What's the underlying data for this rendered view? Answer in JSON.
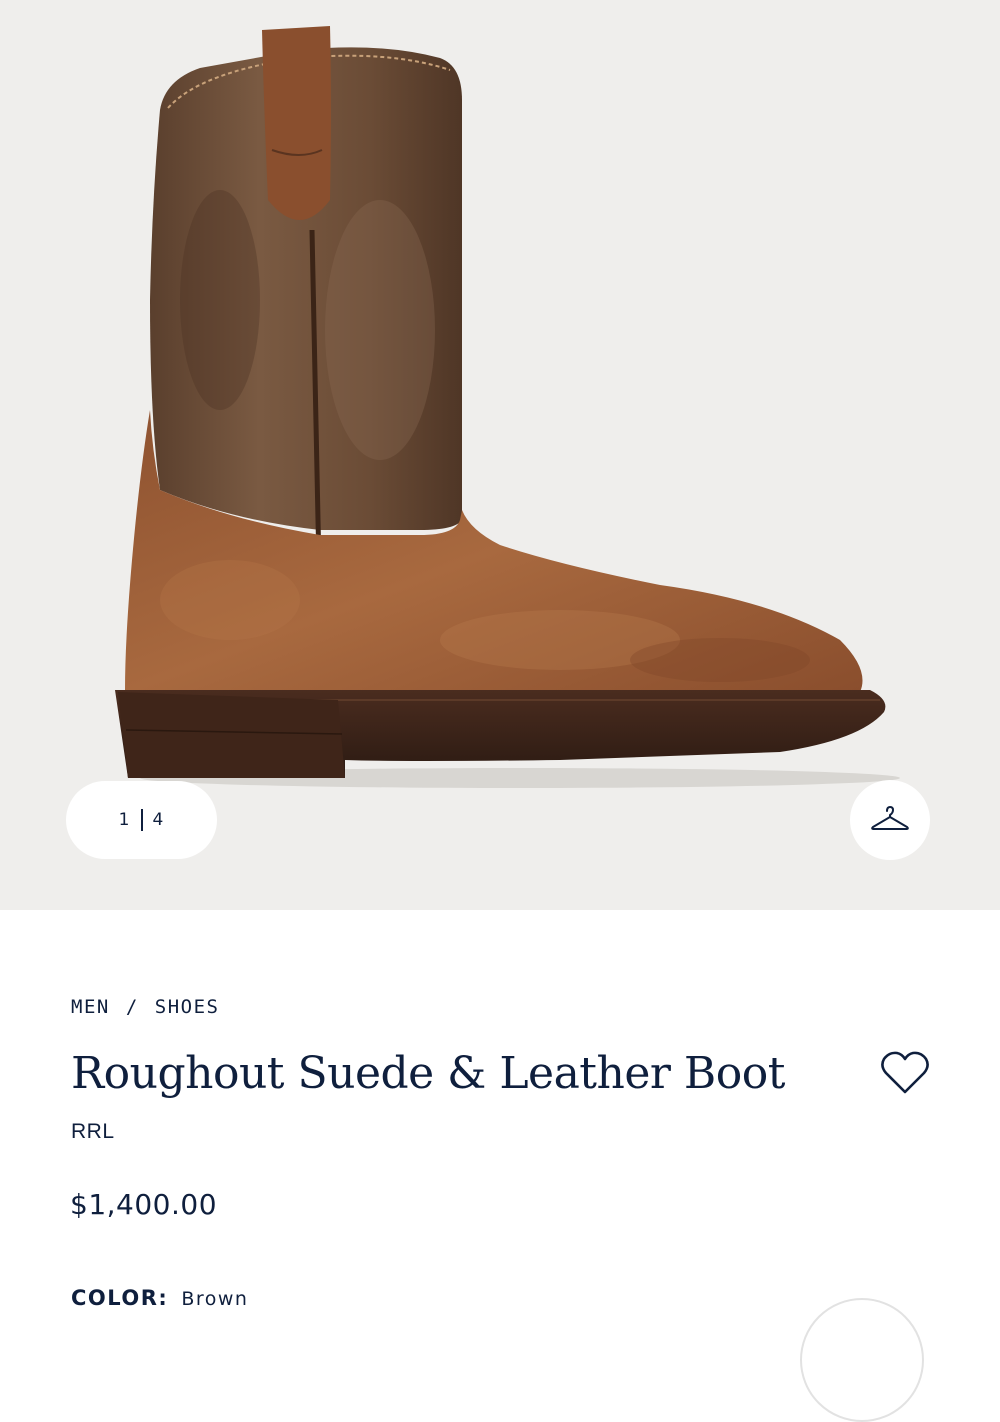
{
  "gallery": {
    "current_index": "1",
    "total": "4",
    "product_image": "brown roughout suede and leather western boot"
  },
  "breadcrumb": {
    "items": [
      "MEN",
      "SHOES"
    ],
    "separator": "/"
  },
  "product": {
    "title": "Roughout Suede & Leather Boot",
    "brand": "RRL",
    "price": "$1,400.00"
  },
  "color": {
    "label": "COLOR:",
    "value": "Brown"
  },
  "icons": {
    "hanger": "hanger-icon",
    "favorite": "heart-icon"
  },
  "colors": {
    "text": "#0f1f3d",
    "gallery_bg": "#efeeec",
    "leather": "#6a4a33",
    "suede": "#9c5c35",
    "sole": "#3e2419"
  }
}
